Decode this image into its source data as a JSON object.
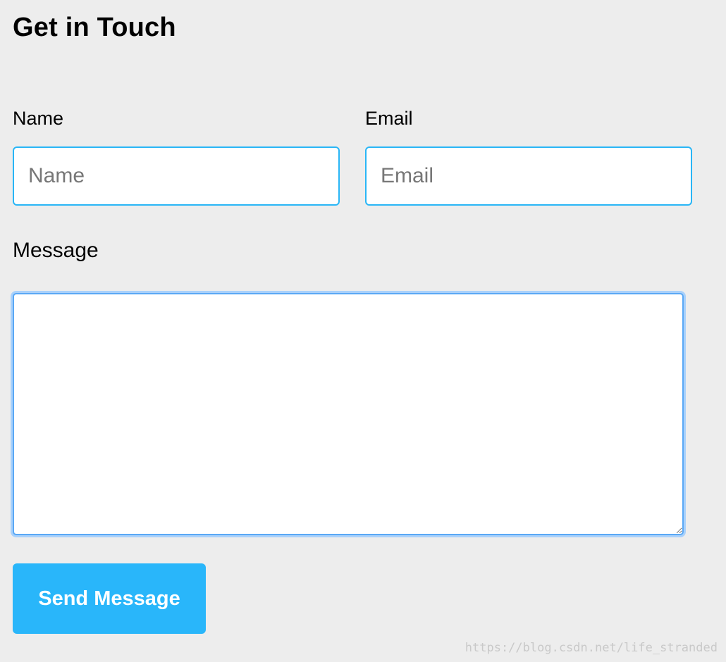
{
  "page": {
    "title": "Get in Touch"
  },
  "form": {
    "name_label": "Name",
    "name_placeholder": "Name",
    "email_label": "Email",
    "email_placeholder": "Email",
    "message_label": "Message",
    "message_value": "",
    "submit_label": "Send Message"
  },
  "watermark": {
    "text": "https://blog.csdn.net/life_stranded"
  },
  "colors": {
    "background": "#ededed",
    "input_border": "#29b6f6",
    "textarea_focus_border": "#5aa8f5",
    "button_background": "#29b6fa",
    "button_text": "#ffffff"
  }
}
